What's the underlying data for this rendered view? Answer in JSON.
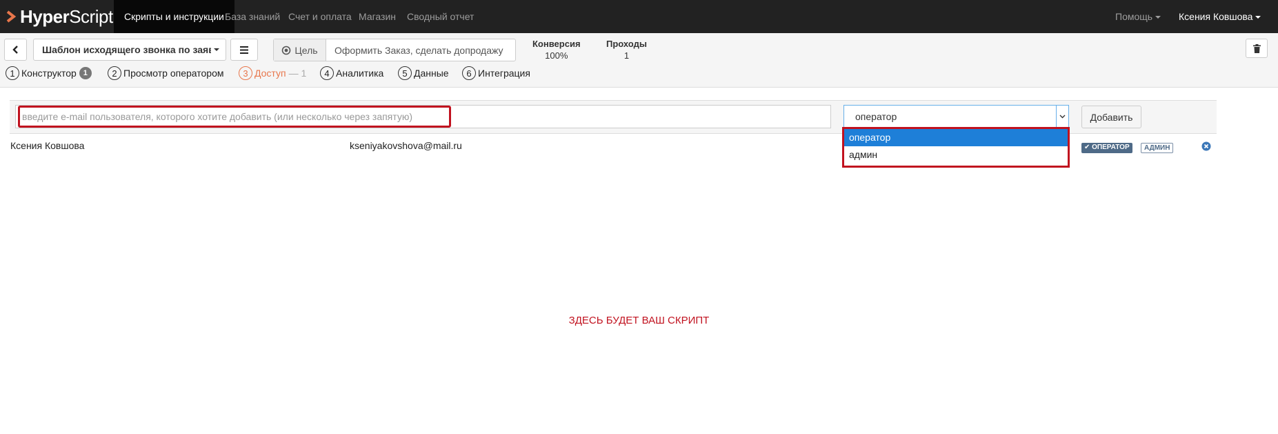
{
  "brand": {
    "bold": "Hyper",
    "light": "Script"
  },
  "nav": {
    "links": [
      "Скрипты и инструкции",
      "База знаний",
      "Счет и оплата",
      "Магазин",
      "Сводный отчет"
    ],
    "help": "Помощь",
    "user": "Ксения Ковшова"
  },
  "toolbar": {
    "back_icon": "arrow-left-icon",
    "template_name": "Шаблон исходящего звонка по заяв",
    "menu_icon": "hamburger-icon",
    "goal_label": "Цель",
    "goal_value": "Оформить Заказ, сделать допродажу",
    "conversion_label": "Конверсия",
    "conversion_value": "100%",
    "passes_label": "Проходы",
    "passes_value": "1",
    "trash_icon": "trash-icon"
  },
  "steps": [
    {
      "num": "1",
      "label": "Конструктор",
      "badge": "1"
    },
    {
      "num": "2",
      "label": "Просмотр оператором"
    },
    {
      "num": "3",
      "label": "Доступ",
      "extra": "— 1"
    },
    {
      "num": "4",
      "label": "Аналитика"
    },
    {
      "num": "5",
      "label": "Данные"
    },
    {
      "num": "6",
      "label": "Интеграция"
    }
  ],
  "access": {
    "email_placeholder": "введите e-mail пользователя, которого хотите добавить (или несколько через запятую)",
    "role_value": "оператор",
    "role_options": [
      "оператор",
      "админ"
    ],
    "add_button": "Добавить",
    "users": [
      {
        "name": "Ксения Ковшова",
        "email": "kseniyakovshova@mail.ru",
        "tag_operator": "✔ ОПЕРАТОР",
        "tag_admin": "АДМИН"
      }
    ]
  },
  "script_placeholder": "ЗДЕСЬ БУДЕТ ВАШ СКРИПТ",
  "colors": {
    "accent_red": "#c1121f",
    "step_current": "#e8764b",
    "select_blue": "#1e7fd8",
    "nav_bg": "#222222"
  }
}
